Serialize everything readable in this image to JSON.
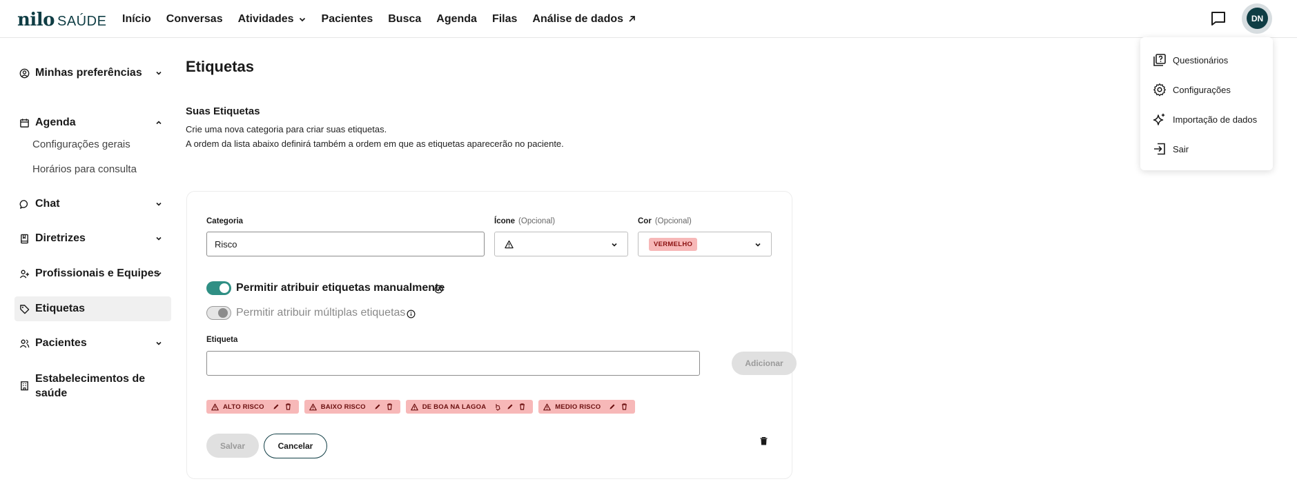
{
  "brand": {
    "logo_main": "nilo",
    "logo_sub": "SAÚDE"
  },
  "nav": {
    "items": [
      "Início",
      "Conversas",
      "Atividades",
      "Pacientes",
      "Busca",
      "Agenda",
      "Filas",
      "Análise de dados"
    ]
  },
  "user": {
    "initials": "DN"
  },
  "user_menu": {
    "items": [
      "Questionários",
      "Configurações",
      "Importação de dados",
      "Sair"
    ]
  },
  "sidebar": {
    "items": [
      "Minhas preferências",
      "Agenda",
      "Chat",
      "Diretrizes",
      "Profissionais e Equipes",
      "Etiquetas",
      "Pacientes",
      "Estabelecimentos de saúde"
    ],
    "agenda_sub": [
      "Configurações gerais",
      "Horários para consulta"
    ],
    "active": "Etiquetas"
  },
  "page": {
    "title": "Etiquetas",
    "section_title": "Suas Etiquetas",
    "desc_line1": "Crie uma nova categoria para criar suas etiquetas.",
    "desc_line2": "A ordem da lista abaixo definirá também a ordem em que as etiquetas aparecerão no paciente."
  },
  "form": {
    "categoria_label": "Categoria",
    "categoria_value": "Risco",
    "icone_label": "Ícone",
    "icone_optional": "(Opcional)",
    "icone_value": "warning-triangle-icon",
    "cor_label": "Cor",
    "cor_optional": "(Opcional)",
    "cor_value": "VERMELHO",
    "cor_color": "#f7b8b8",
    "toggle_manual": {
      "label": "Permitir atribuir etiquetas manualmente",
      "on": true
    },
    "toggle_multiple": {
      "label": "Permitir atribuir múltiplas etiquetas",
      "on": false
    },
    "etiqueta_label": "Etiqueta",
    "etiqueta_value": "",
    "add_button": "Adicionar",
    "tags": [
      "ALTO RISCO",
      "BAIXO RISCO",
      "DE BOA NA LAGOA",
      "MEDIO RISCO"
    ],
    "save_button": "Salvar",
    "cancel_button": "Cancelar"
  },
  "colors": {
    "brand": "#0f3d44",
    "toggle_on": "#2f8f84",
    "tag_bg": "#f7b8b8"
  }
}
